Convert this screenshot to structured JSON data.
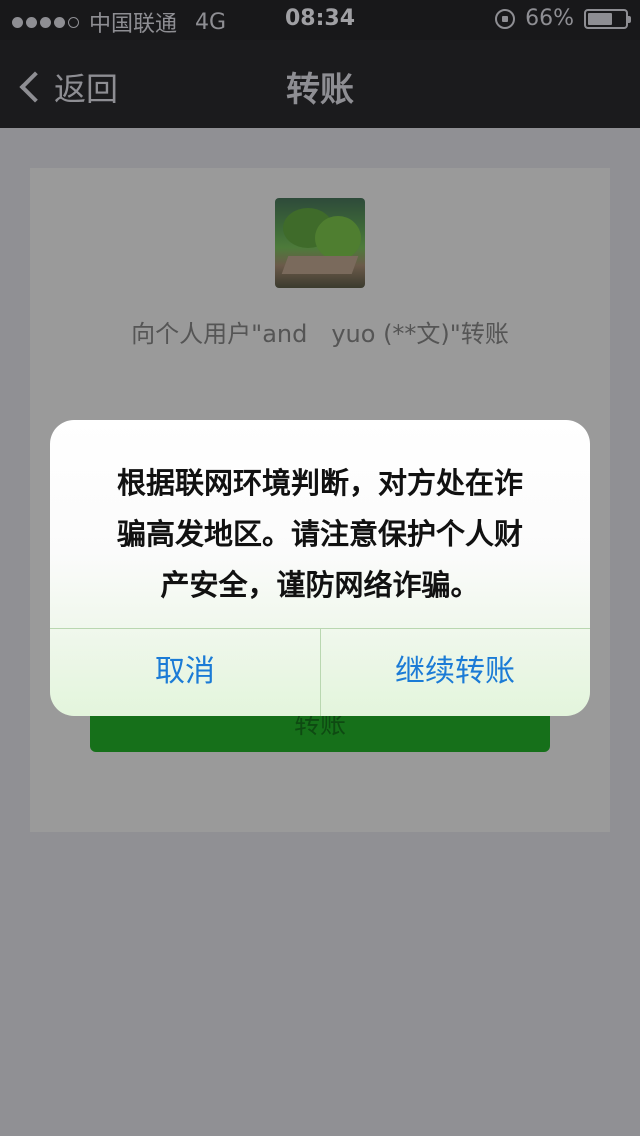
{
  "status_bar": {
    "signal_icon": "signal-dots-icon",
    "carrier": "中国联通",
    "network": "4G",
    "time": "08:34",
    "lock_icon": "rotation-lock-icon",
    "battery_percent": "66%",
    "battery_level": 0.66
  },
  "nav": {
    "back_label": "返回",
    "title": "转账"
  },
  "recipient": {
    "text": "向个人用户\"and　yuo (**文)\"转账"
  },
  "transfer_button": {
    "label": "转账"
  },
  "dialog": {
    "message_line1": "根据联网环境判断，对方处在诈",
    "message_line2": "骗高发地区。请注意保护个人财",
    "message_line3": "产安全，谨防网络诈骗。",
    "cancel_label": "取消",
    "confirm_label": "继续转账"
  },
  "colors": {
    "accent_blue": "#1b7bd6",
    "wechat_green": "#16701a"
  }
}
